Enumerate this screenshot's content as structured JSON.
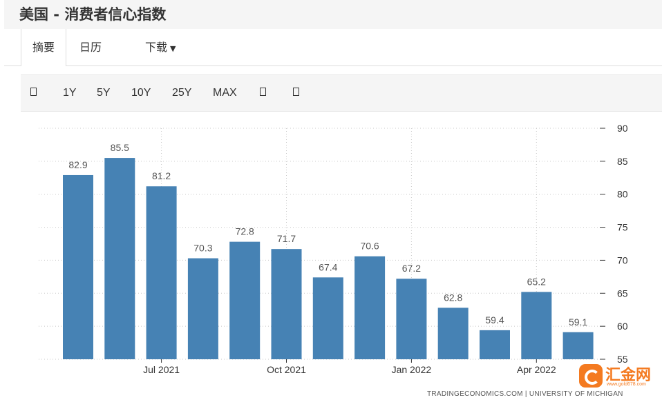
{
  "page": {
    "title": "美国 - 消费者信心指数"
  },
  "tabs": [
    {
      "label": "摘要",
      "active": true
    },
    {
      "label": "日历",
      "active": false
    },
    {
      "label": "下载",
      "active": false
    }
  ],
  "range_buttons": {
    "y1": "1Y",
    "y5": "5Y",
    "y10": "10Y",
    "y25": "25Y",
    "max": "MAX"
  },
  "icons": {
    "calendar": "calendar-icon",
    "bar_chart": "bar-chart-icon",
    "compare": "compare-icon",
    "dropdown": "caret-down-icon"
  },
  "footer": {
    "source": "TRADINGECONOMICS.COM  |  UNIVERSITY OF MICHIGAN"
  },
  "watermark": {
    "brand": "汇金网",
    "url": "www.gold678.com"
  },
  "colors": {
    "bar": "#4682b4",
    "grid": "#c8c8c8",
    "watermark": "#f47a20"
  },
  "chart_data": {
    "type": "bar",
    "title": "",
    "xlabel": "",
    "ylabel": "",
    "ylim": [
      55,
      90
    ],
    "y_ticks": [
      55,
      60,
      65,
      70,
      75,
      80,
      85,
      90
    ],
    "y_axis_position": "right",
    "grid": true,
    "categories": [
      "2021-05",
      "2021-06",
      "2021-07",
      "2021-08",
      "2021-09",
      "2021-10",
      "2021-11",
      "2021-12",
      "2022-01",
      "2022-02",
      "2022-03",
      "2022-04",
      "2022-05"
    ],
    "x_tick_labels": [
      {
        "label": "Jul 2021",
        "category": "2021-07"
      },
      {
        "label": "Oct 2021",
        "category": "2021-10"
      },
      {
        "label": "Jan 2022",
        "category": "2022-01"
      },
      {
        "label": "Apr 2022",
        "category": "2022-04"
      }
    ],
    "series": [
      {
        "values": [
          82.9,
          85.5,
          81.2,
          70.3,
          72.8,
          71.7,
          67.4,
          70.6,
          67.2,
          62.8,
          59.4,
          65.2,
          59.1
        ]
      }
    ]
  }
}
